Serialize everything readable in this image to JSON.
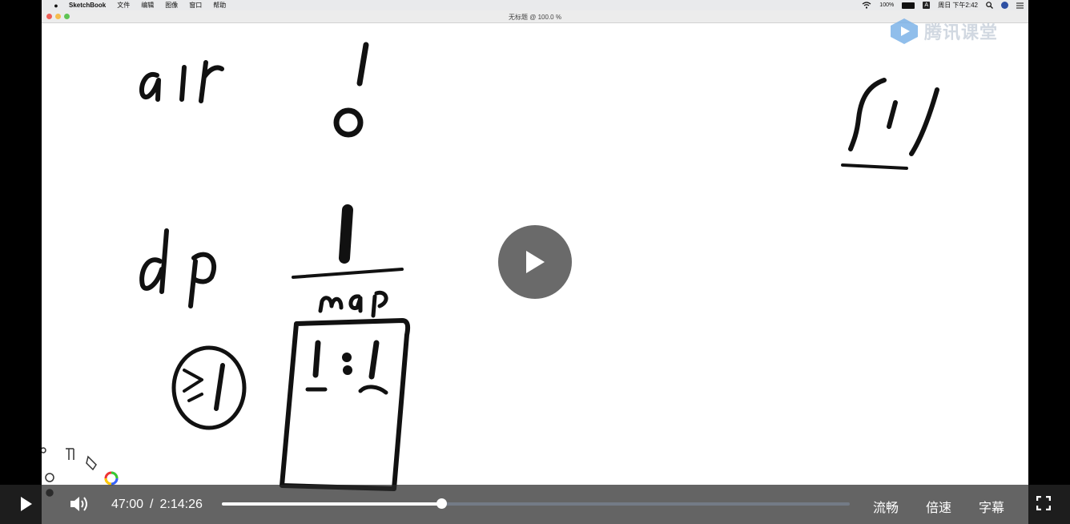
{
  "menubar": {
    "app_name": "SketchBook",
    "menus": [
      "文件",
      "编辑",
      "图像",
      "窗口",
      "帮助"
    ],
    "battery": "100%",
    "input_method": "A",
    "clock": "周日 下午2:42"
  },
  "window": {
    "title": "无标题 @ 100.0 %"
  },
  "watermark": {
    "text": "腾讯课堂"
  },
  "player": {
    "current_time": "47:00",
    "separator": "/",
    "duration": "2:14:26",
    "progress_fraction": 0.35,
    "quality_label": "流畅",
    "speed_label": "倍速",
    "subtitle_label": "字幕"
  },
  "colors": {
    "accent_play": "#505050",
    "progress_track": "#737b86",
    "watermark_blue": "#4a90d9"
  },
  "icons": [
    "apple-icon",
    "wifi-icon",
    "search-icon",
    "list-icon",
    "play-icon",
    "volume-icon",
    "fullscreen-icon",
    "color-wheel-icon"
  ]
}
